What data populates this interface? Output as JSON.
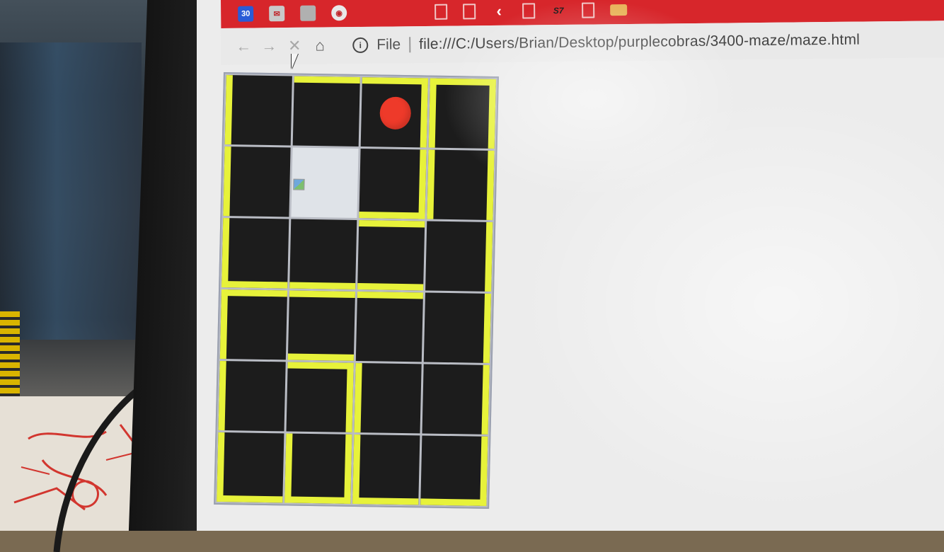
{
  "bookmarks": {
    "calendar_date": "30",
    "items": [
      "calendar-icon",
      "gmail-icon",
      "apple-icon",
      "shield-icon",
      "doc-icon",
      "doc-icon",
      "back-icon",
      "s7-icon",
      "doc-icon",
      "folder-icon"
    ],
    "s7_label": "S7"
  },
  "toolbar": {
    "back_glyph": "←",
    "forward_glyph": "→",
    "stop_glyph": "✕",
    "home_glyph": "⌂",
    "info_glyph": "i",
    "scheme_label": "File",
    "url": "file:///C:/Users/Brian/Desktop/purplecobras/3400-maze/maze.html"
  },
  "colors": {
    "bookmarks_bar": "#d7262b",
    "wall": "#e7f23a",
    "cell": "#1c1c1c",
    "ball": "#ee3a2a",
    "empty_cell": "#dfe3e8"
  },
  "maze": {
    "rows": 6,
    "cols": 4,
    "walls": [
      [
        [
          "l"
        ],
        [
          "t"
        ],
        [
          "t",
          "r"
        ],
        [
          "t",
          "l",
          "r"
        ]
      ],
      [
        [
          "l"
        ],
        [],
        [
          "r",
          "b"
        ],
        [
          "l",
          "r"
        ]
      ],
      [
        [
          "l",
          "b"
        ],
        [
          "b"
        ],
        [
          "t",
          "b"
        ],
        [
          "r"
        ]
      ],
      [
        [
          "l",
          "t"
        ],
        [
          "t",
          "b"
        ],
        [
          "t"
        ],
        [
          "r"
        ]
      ],
      [
        [
          "l"
        ],
        [
          "t",
          "r"
        ],
        [
          "l"
        ],
        [
          "r"
        ]
      ],
      [
        [
          "l",
          "b"
        ],
        [
          "l",
          "r",
          "b"
        ],
        [
          "l",
          "b"
        ],
        [
          "r",
          "b"
        ]
      ]
    ],
    "ball_position": {
      "row": 0,
      "col": 2
    },
    "empty_cell": {
      "row": 1,
      "col": 1
    }
  }
}
